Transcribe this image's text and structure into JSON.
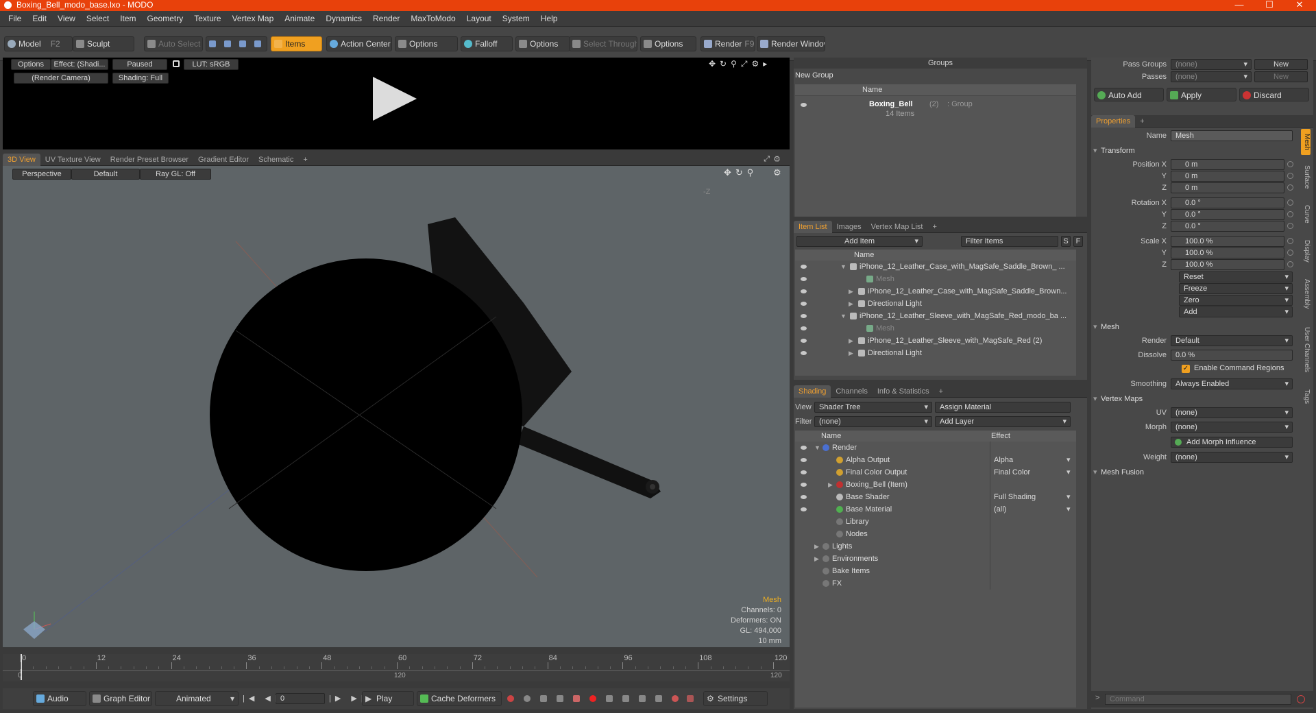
{
  "window": {
    "title": "Boxing_Bell_modo_base.lxo - MODO",
    "minimize": "—",
    "maximize": "☐",
    "close": "✕"
  },
  "menu": [
    "File",
    "Edit",
    "View",
    "Select",
    "Item",
    "Geometry",
    "Texture",
    "Vertex Map",
    "Animate",
    "Dynamics",
    "Render",
    "MaxToModo",
    "Layout",
    "System",
    "Help"
  ],
  "toolbar": {
    "model": "Model",
    "model_key": "F2",
    "sculpt": "Sculpt",
    "auto_select": "Auto Select",
    "items": "Items",
    "action_center": "Action Center",
    "options1": "Options",
    "falloff": "Falloff",
    "options2": "Options",
    "select_through": "Select Through",
    "options3": "Options",
    "render": "Render",
    "render_key": "F9",
    "render_window": "Render Window"
  },
  "preview": {
    "options": "Options",
    "effect": "Effect: (Shadi...",
    "paused": "Paused",
    "lut": "LUT: sRGB",
    "camera": "(Render Camera)",
    "shading": "Shading: Full"
  },
  "view_tabs": [
    "3D View",
    "UV Texture View",
    "Render Preset Browser",
    "Gradient Editor",
    "Schematic",
    "+"
  ],
  "viewport": {
    "perspective": "Perspective",
    "default": "Default",
    "raygl": "Ray GL: Off",
    "axis_label": "-Z",
    "info_title": "Mesh",
    "info": [
      "Channels: 0",
      "Deformers: ON",
      "GL: 494,000",
      "10 mm"
    ]
  },
  "timeline": {
    "ticks": [
      "0",
      "12",
      "24",
      "36",
      "48",
      "60",
      "72",
      "84",
      "96",
      "108",
      "120"
    ],
    "sub_ticks": [
      "0",
      "120",
      "120"
    ]
  },
  "bottombar": {
    "audio": "Audio",
    "graph_editor": "Graph Editor",
    "animated": "Animated",
    "frame": "0",
    "play": "Play",
    "cache": "Cache Deformers",
    "settings": "Settings"
  },
  "groups": {
    "title": "Groups",
    "new_group": "New Group",
    "col_name": "Name",
    "group_name": "Boxing_Bell",
    "group_count": "(2)",
    "group_type": ": Group",
    "group_items": "14 Items"
  },
  "pass": {
    "pass_groups": "Pass Groups",
    "passes": "Passes",
    "none1": "(none)",
    "none2": "(none)",
    "new1": "New",
    "new2": "New"
  },
  "actions": {
    "auto_add": "Auto Add",
    "apply": "Apply",
    "discard": "Discard"
  },
  "itemlist": {
    "tabs": [
      "Item List",
      "Images",
      "Vertex Map List",
      "+"
    ],
    "add_item": "Add Item",
    "filter": "Filter Items",
    "f_s": "S",
    "f_f": "F",
    "col_name": "Name",
    "rows": [
      {
        "text": "iPhone_12_Leather_Case_with_MagSafe_Saddle_Brown_ ...",
        "indent": 0,
        "dim": false
      },
      {
        "text": "Mesh",
        "indent": 2,
        "dim": true
      },
      {
        "text": "iPhone_12_Leather_Case_with_MagSafe_Saddle_Brown...",
        "indent": 1,
        "dim": false
      },
      {
        "text": "Directional Light",
        "indent": 1,
        "dim": false
      },
      {
        "text": "iPhone_12_Leather_Sleeve_with_MagSafe_Red_modo_ba ...",
        "indent": 0,
        "dim": false
      },
      {
        "text": "Mesh",
        "indent": 2,
        "dim": true
      },
      {
        "text": "iPhone_12_Leather_Sleeve_with_MagSafe_Red (2)",
        "indent": 1,
        "dim": false
      },
      {
        "text": "Directional Light",
        "indent": 1,
        "dim": false
      }
    ]
  },
  "shading": {
    "tabs": [
      "Shading",
      "Channels",
      "Info & Statistics",
      "+"
    ],
    "view_label": "View",
    "view_value": "Shader Tree",
    "assign": "Assign Material",
    "filter_label": "Filter",
    "filter_value": "(none)",
    "add_layer": "Add Layer",
    "col_name": "Name",
    "col_effect": "Effect",
    "rows": [
      {
        "name": "Render",
        "effect": "",
        "indent": 0,
        "color": "#4a6fd0"
      },
      {
        "name": "Alpha Output",
        "effect": "Alpha",
        "indent": 1,
        "color": "#d0a030"
      },
      {
        "name": "Final Color Output",
        "effect": "Final Color",
        "indent": 1,
        "color": "#d0a030"
      },
      {
        "name": "Boxing_Bell (Item)",
        "effect": "",
        "indent": 1,
        "color": "#c03030"
      },
      {
        "name": "Base Shader",
        "effect": "Full Shading",
        "indent": 1,
        "color": "#bbbbbb"
      },
      {
        "name": "Base Material",
        "effect": "(all)",
        "indent": 1,
        "color": "#50b050"
      },
      {
        "name": "Library",
        "effect": "",
        "indent": 1,
        "color": ""
      },
      {
        "name": "Nodes",
        "effect": "",
        "indent": 1,
        "color": ""
      },
      {
        "name": "Lights",
        "effect": "",
        "indent": 0,
        "color": ""
      },
      {
        "name": "Environments",
        "effect": "",
        "indent": 0,
        "color": ""
      },
      {
        "name": "Bake Items",
        "effect": "",
        "indent": 0,
        "color": ""
      },
      {
        "name": "FX",
        "effect": "",
        "indent": 0,
        "color": ""
      }
    ]
  },
  "properties": {
    "tab": "Properties",
    "plus": "+",
    "name_label": "Name",
    "name_value": "Mesh",
    "transform": "Transform",
    "position": [
      {
        "label": "Position X",
        "value": "0 m"
      },
      {
        "label": "Y",
        "value": "0 m"
      },
      {
        "label": "Z",
        "value": "0 m"
      }
    ],
    "rotation": [
      {
        "label": "Rotation X",
        "value": "0.0 °"
      },
      {
        "label": "Y",
        "value": "0.0 °"
      },
      {
        "label": "Z",
        "value": "0.0 °"
      }
    ],
    "scale": [
      {
        "label": "Scale X",
        "value": "100.0 %"
      },
      {
        "label": "Y",
        "value": "100.0 %"
      },
      {
        "label": "Z",
        "value": "100.0 %"
      }
    ],
    "reset": "Reset",
    "freeze": "Freeze",
    "zero": "Zero",
    "add": "Add",
    "mesh": "Mesh",
    "render_label": "Render",
    "render_value": "Default",
    "dissolve_label": "Dissolve",
    "dissolve_value": "0.0 %",
    "enable_cmd": "Enable Command Regions",
    "smoothing_label": "Smoothing",
    "smoothing_value": "Always Enabled",
    "vertex_maps": "Vertex Maps",
    "uv_label": "UV",
    "uv_value": "(none)",
    "morph_label": "Morph",
    "morph_value": "(none)",
    "add_morph": "Add Morph Influence",
    "weight_label": "Weight",
    "weight_value": "(none)",
    "mesh_fusion": "Mesh Fusion",
    "side_tabs": [
      "Mesh",
      "Surface",
      "Curve",
      "Display",
      "Assembly",
      "User Channels",
      "Tags"
    ]
  },
  "command": {
    "placeholder": "Command"
  }
}
